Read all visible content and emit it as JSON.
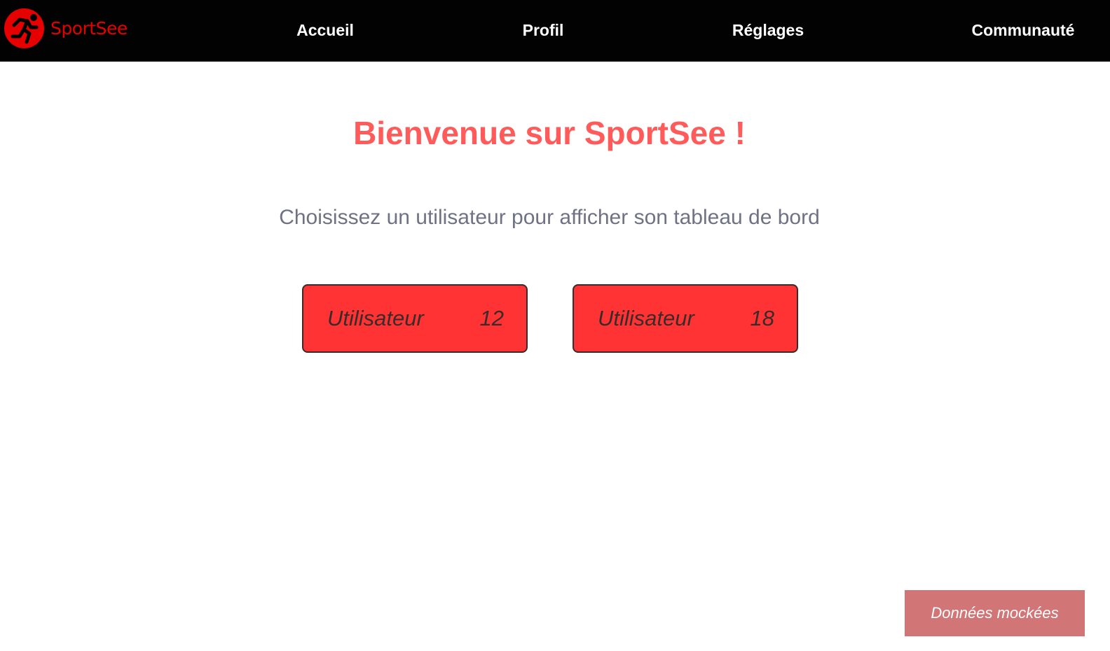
{
  "header": {
    "logo_text": "SportSee",
    "nav": [
      {
        "label": "Accueil"
      },
      {
        "label": "Profil"
      },
      {
        "label": "Réglages"
      },
      {
        "label": "Communauté"
      }
    ]
  },
  "main": {
    "title": "Bienvenue sur SportSee !",
    "subtitle": "Choisissez un utilisateur pour afficher son tableau de bord",
    "users": [
      {
        "label": "Utilisateur",
        "id": "12"
      },
      {
        "label": "Utilisateur",
        "id": "18"
      }
    ]
  },
  "footer": {
    "mock_data_label": "Données mockées"
  },
  "colors": {
    "brand": "#e60000",
    "title": "#ff5b5b",
    "button": "#ff3333",
    "mock": "#d27577",
    "header": "#020203"
  }
}
